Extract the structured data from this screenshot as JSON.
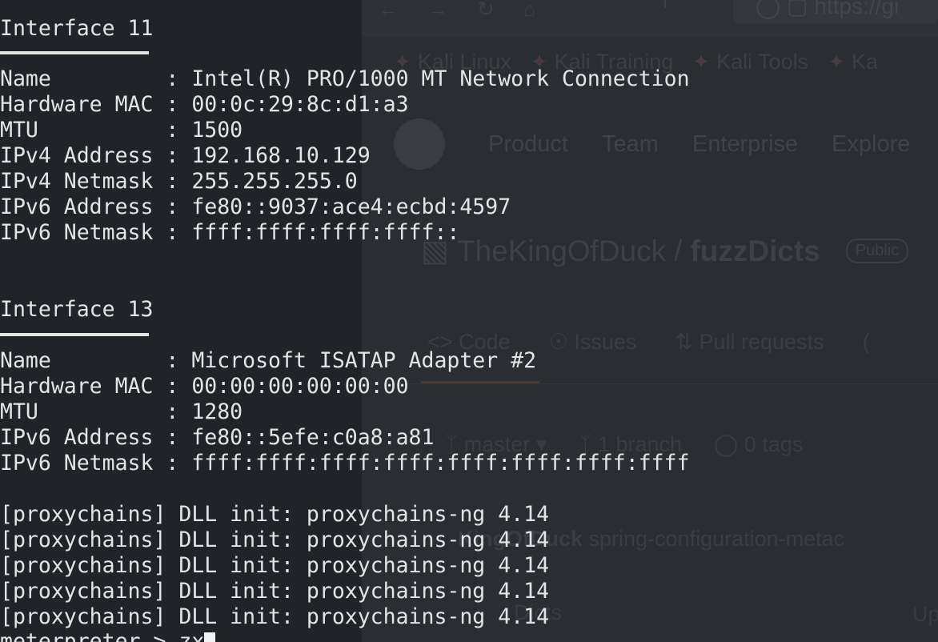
{
  "background_browser": {
    "nav_icons": [
      "back-icon",
      "forward-icon",
      "reload-icon",
      "home-icon"
    ],
    "url_text": "https://gi",
    "bookmarks": [
      "Kali Linux",
      "Kali Training",
      "Kali Tools",
      "Ka"
    ],
    "header": {
      "nav_items": [
        "Product",
        "Team",
        "Enterprise",
        "Explore"
      ]
    },
    "repo": {
      "owner": "TheKingOfDuck",
      "separator": "/",
      "name": "fuzzDicts",
      "visibility": "Public"
    },
    "tabs": [
      "Code",
      "Issues",
      "Pull requests",
      "("
    ],
    "branch_bar": {
      "branch": "master",
      "branches": "1 branch",
      "tags": "0 tags"
    },
    "commit_row": {
      "author": "KingOfDuck",
      "message": "spring-configuration-metac"
    },
    "file_row": {
      "name": "Dicts",
      "right": "Up"
    }
  },
  "terminal": {
    "interface_11": {
      "title": "Interface 11",
      "rows": [
        "Name         : Intel(R) PRO/1000 MT Network Connection",
        "Hardware MAC : 00:0c:29:8c:d1:a3",
        "MTU          : 1500",
        "IPv4 Address : 192.168.10.129",
        "IPv4 Netmask : 255.255.255.0",
        "IPv6 Address : fe80::9037:ace4:ecbd:4597",
        "IPv6 Netmask : ffff:ffff:ffff:ffff::"
      ]
    },
    "interface_13": {
      "title": "Interface 13",
      "rows": [
        "Name         : Microsoft ISATAP Adapter #2",
        "Hardware MAC : 00:00:00:00:00:00",
        "MTU          : 1280",
        "IPv6 Address : fe80::5efe:c0a8:a81",
        "IPv6 Netmask : ffff:ffff:ffff:ffff:ffff:ffff:ffff:ffff"
      ]
    },
    "proxychains_lines": [
      "[proxychains] DLL init: proxychains-ng 4.14",
      "[proxychains] DLL init: proxychains-ng 4.14",
      "[proxychains] DLL init: proxychains-ng 4.14",
      "[proxychains] DLL init: proxychains-ng 4.14",
      "[proxychains] DLL init: proxychains-ng 4.14"
    ],
    "prompt": "meterpreter > zx"
  }
}
